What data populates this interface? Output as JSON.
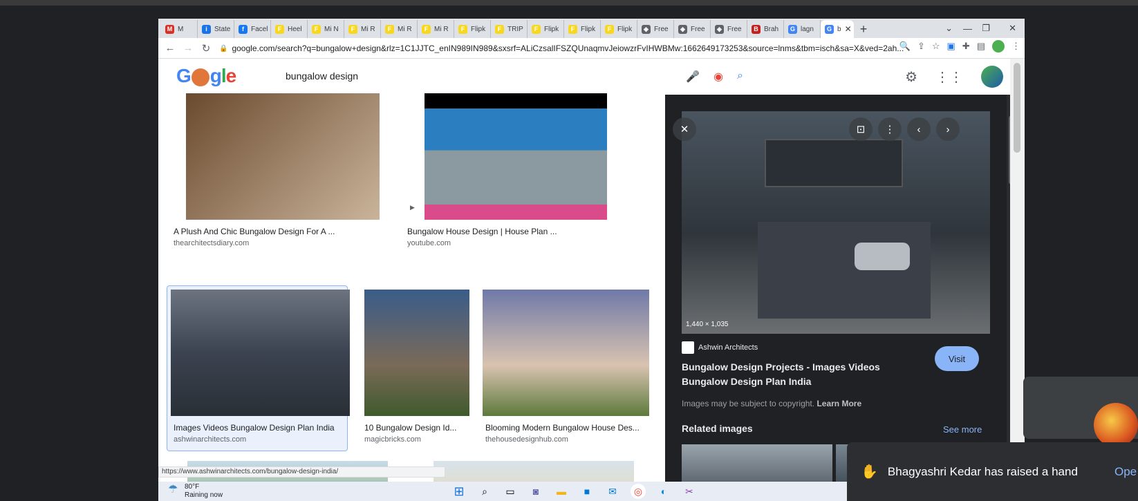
{
  "browser": {
    "tabs": [
      {
        "label": "M",
        "fav_color": "#d93025",
        "fav_glyph": "M"
      },
      {
        "label": "State",
        "fav_color": "#1a73e8",
        "fav_glyph": "i"
      },
      {
        "label": "Facel",
        "fav_color": "#1877f2",
        "fav_glyph": "f"
      },
      {
        "label": "Heel",
        "fav_color": "#f9d71c",
        "fav_glyph": "F"
      },
      {
        "label": "Mi N",
        "fav_color": "#f9d71c",
        "fav_glyph": "F"
      },
      {
        "label": "Mi R",
        "fav_color": "#f9d71c",
        "fav_glyph": "F"
      },
      {
        "label": "Mi R",
        "fav_color": "#f9d71c",
        "fav_glyph": "F"
      },
      {
        "label": "Mi R",
        "fav_color": "#f9d71c",
        "fav_glyph": "F"
      },
      {
        "label": "Flipk",
        "fav_color": "#f9d71c",
        "fav_glyph": "F"
      },
      {
        "label": "TRIP",
        "fav_color": "#f9d71c",
        "fav_glyph": "F"
      },
      {
        "label": "Flipk",
        "fav_color": "#f9d71c",
        "fav_glyph": "F"
      },
      {
        "label": "Flipk",
        "fav_color": "#f9d71c",
        "fav_glyph": "F"
      },
      {
        "label": "Flipk",
        "fav_color": "#f9d71c",
        "fav_glyph": "F"
      },
      {
        "label": "Free",
        "fav_color": "#5f6368",
        "fav_glyph": "◈"
      },
      {
        "label": "Free",
        "fav_color": "#5f6368",
        "fav_glyph": "◈"
      },
      {
        "label": "Free",
        "fav_color": "#5f6368",
        "fav_glyph": "◈"
      },
      {
        "label": "Brah",
        "fav_color": "#c5221f",
        "fav_glyph": "B"
      },
      {
        "label": "lagn",
        "fav_color": "#4285f4",
        "fav_glyph": "G"
      }
    ],
    "active_tab": {
      "label": "b",
      "fav_glyph": "G"
    },
    "url": "google.com/search?q=bungalow+design&rlz=1C1JJTC_enIN989IN989&sxsrf=ALiCzsalIFSZQUnaqmvJeiowzrFvIHWBMw:1662649173253&source=lnms&tbm=isch&sa=X&ved=2ah...",
    "status_url": "https://www.ashwinarchitects.com/bungalow-design-india/"
  },
  "search": {
    "query": "bungalow design",
    "logo": "Google"
  },
  "results": [
    {
      "title": "A Plush And Chic Bungalow Design For A ...",
      "source": "thearchitectsdiary.com",
      "colors": [
        "#6b4a2f",
        "#c9b49a"
      ]
    },
    {
      "title": "Bungalow House Design | House Plan ...",
      "source": "youtube.com",
      "colors": [
        "#2b7fc1",
        "#8a9aa0"
      ]
    },
    {
      "title": "Images Videos Bungalow Design Plan India",
      "source": "ashwinarchitects.com",
      "colors": [
        "#3b4350",
        "#6c7480"
      ]
    },
    {
      "title": "10 Bungalow Design Id...",
      "source": "magicbricks.com",
      "colors": [
        "#3a5c8a",
        "#7a6a58"
      ]
    },
    {
      "title": "Blooming Modern Bungalow House Des...",
      "source": "thehousedesignhub.com",
      "colors": [
        "#6f79a8",
        "#d9c3b0"
      ]
    }
  ],
  "preview": {
    "dimensions": "1,440 × 1,035",
    "site": "Ashwin Architects",
    "title": "Bungalow Design Projects - Images Videos Bungalow Design Plan India",
    "visit_label": "Visit",
    "copyright": "Images may be subject to copyright.",
    "learn_more": "Learn More",
    "related_label": "Related images",
    "see_more": "See more"
  },
  "taskbar": {
    "temperature": "80°F",
    "weather": "Raining now"
  },
  "notification": {
    "text": "Bhagyashri Kedar has raised a hand",
    "action": "Ope"
  }
}
